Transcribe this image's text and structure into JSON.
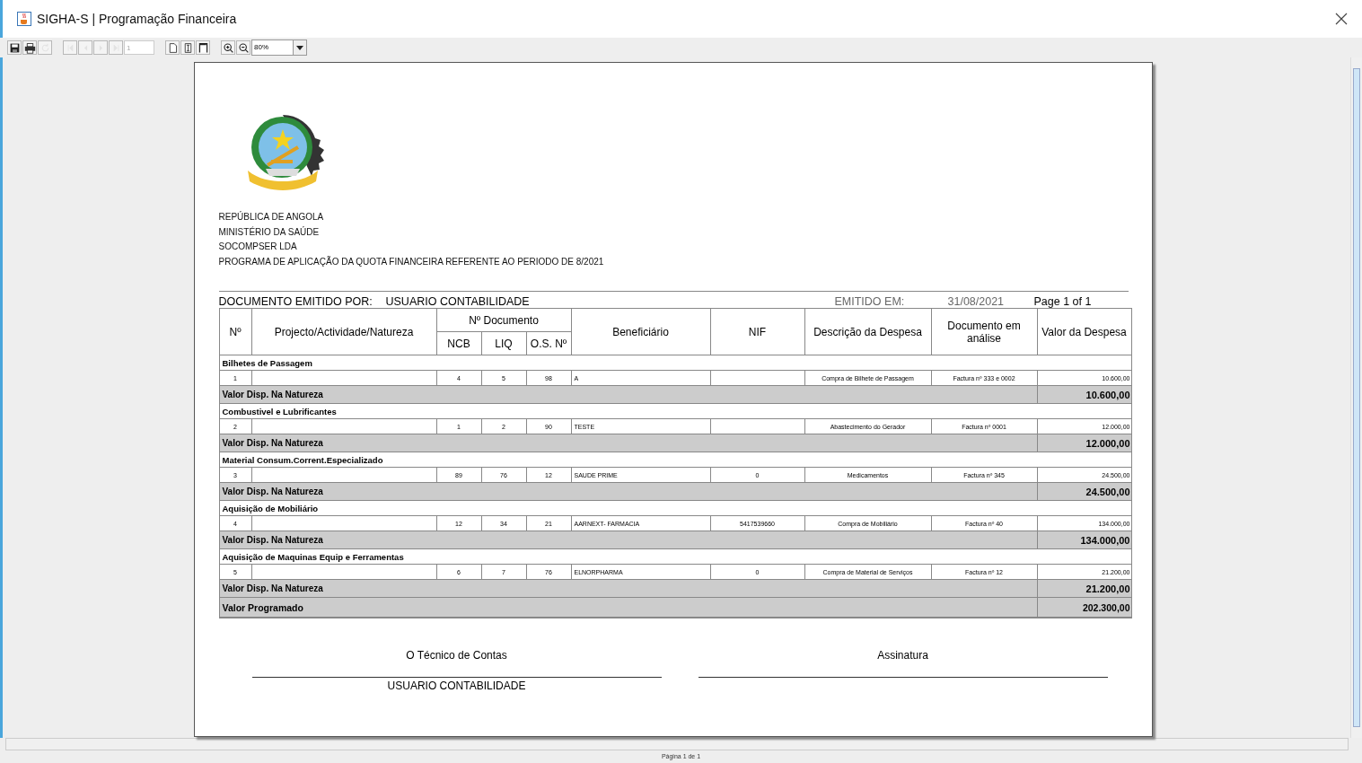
{
  "window": {
    "title": "SIGHA-S | Programação Financeira"
  },
  "toolbar": {
    "buttons": [
      {
        "kind": "save",
        "disabled": false
      },
      {
        "kind": "print",
        "disabled": false
      },
      {
        "kind": "reload",
        "disabled": true
      },
      {
        "kind": "first",
        "disabled": true
      },
      {
        "kind": "prev",
        "disabled": true
      },
      {
        "kind": "next",
        "disabled": true
      },
      {
        "kind": "last",
        "disabled": true
      },
      {
        "kind": "page",
        "disabled": false
      },
      {
        "kind": "actual",
        "disabled": false
      },
      {
        "kind": "fit-page",
        "disabled": false
      },
      {
        "kind": "fit-width",
        "disabled": false
      },
      {
        "kind": "zoom-in",
        "disabled": false
      },
      {
        "kind": "zoom-out",
        "disabled": false
      },
      {
        "kind": "zoom",
        "disabled": false
      }
    ],
    "page": "1",
    "zoom": "80%"
  },
  "report": {
    "header_lines": [
      "REPÚBLICA DE ANGOLA",
      "MINISTÉRIO DA SAÚDE",
      "SOCOMPSER LDA",
      "PROGRAMA DE APLICAÇÃO DA QUOTA FINANCEIRA REFERENTE AO PERIODO DE 8/2021"
    ],
    "issued_by_label": "DOCUMENTO EMITIDO POR:",
    "issued_by": "USUARIO CONTABILIDADE",
    "issued_on_label": "EMITIDO EM:",
    "issued_on": "31/08/2021",
    "page_info": "Page 1 of 1",
    "table": {
      "columns": [
        {
          "label": "Nº"
        },
        {
          "label": "Projecto/Actividade/Natureza"
        },
        {
          "label": "Nº Documento",
          "children": [
            "NCB",
            "LIQ",
            "O.S. Nº"
          ]
        },
        {
          "label": "Beneficiário"
        },
        {
          "label": "NIF"
        },
        {
          "label": "Descrição da Despesa"
        },
        {
          "label": "Documento em análise"
        },
        {
          "label": "Valor  da Despesa"
        }
      ],
      "groups": [
        {
          "name": "Bilhetes de Passagem",
          "rows": [
            {
              "n": "1",
              "ncb": "4",
              "liq": "5",
              "os": "98",
              "beneficiario": "A",
              "descricao": "Compra de Bilhete de Passagem",
              "documento": "Factura nº 333 e 0002",
              "valor": "10.600,00"
            }
          ],
          "subtotal_label": "Valor Disp. Na Natureza",
          "subtotal": "10.600,00"
        },
        {
          "name": "Combustivel e Lubrificantes",
          "rows": [
            {
              "n": "2",
              "ncb": "1",
              "liq": "2",
              "os": "90",
              "beneficiario": "TESTE",
              "descricao": "Abastecimento do Gerador",
              "documento": "Factura nº 0001",
              "valor": "12.000,00"
            }
          ],
          "subtotal_label": "Valor Disp. Na Natureza",
          "subtotal": "12.000,00"
        },
        {
          "name": "Material Consum.Corrent.Especializado",
          "rows": [
            {
              "n": "3",
              "ncb": "89",
              "liq": "76",
              "os": "12",
              "beneficiario": "SAUDE PRIME",
              "nif": "0",
              "descricao": "Medicamentos",
              "documento": "Factura nº 345",
              "valor": "24.500,00"
            }
          ],
          "subtotal_label": "Valor Disp. Na Natureza",
          "subtotal": "24.500,00"
        },
        {
          "name": "Aquisição de Mobiliário",
          "rows": [
            {
              "n": "4",
              "ncb": "12",
              "liq": "34",
              "os": "21",
              "beneficiario": "AARNEXT- FARMACIA",
              "nif": "5417539660",
              "descricao": "Compra de Mobiliário",
              "documento": "Factura nº 40",
              "valor": "134.000,00"
            }
          ],
          "subtotal_label": "Valor Disp. Na Natureza",
          "subtotal": "134.000,00"
        },
        {
          "name": "Aquisição de Maquinas Equip e Ferramentas",
          "rows": [
            {
              "n": "5",
              "ncb": "6",
              "liq": "7",
              "os": "76",
              "beneficiario": "ELNORPHARMA",
              "nif": "0",
              "descricao": "Compra de Material de Serviços",
              "documento": "Factura nº 12",
              "valor": "21.200,00"
            }
          ],
          "subtotal_label": "Valor Disp. Na Natureza",
          "subtotal": "21.200,00"
        }
      ],
      "total_label": "Valor Programado",
      "total": "202.300,00"
    },
    "signatures": [
      {
        "label": "O Técnico de Contas",
        "name": "USUARIO CONTABILIDADE"
      },
      {
        "label": "Assinatura"
      }
    ]
  },
  "status_bar": "Página 1 de 1"
}
